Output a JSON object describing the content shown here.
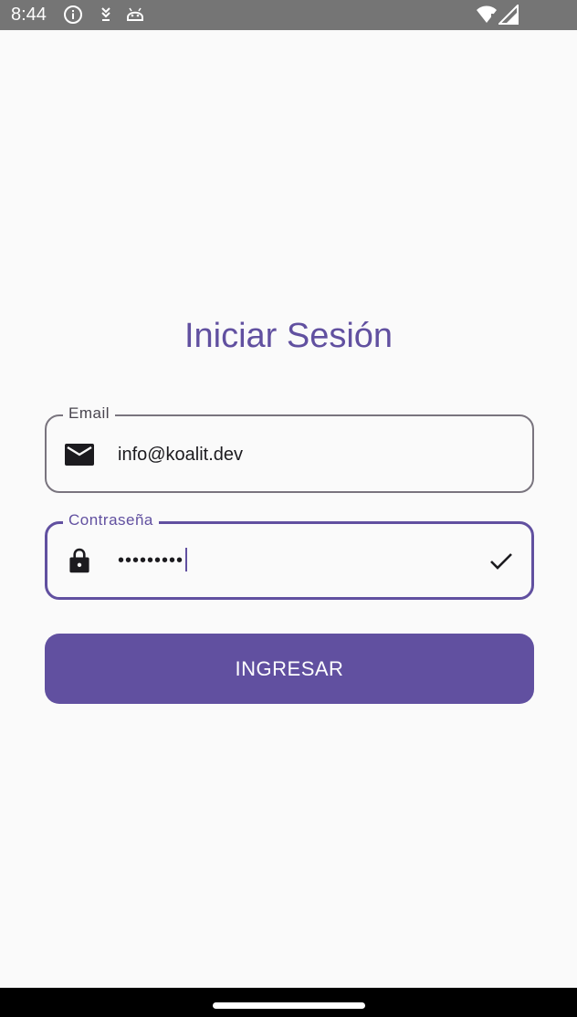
{
  "status_bar": {
    "time": "8:44",
    "icons": [
      "info-icon",
      "download-icon",
      "android-icon",
      "wifi-icon",
      "signal-icon"
    ]
  },
  "login": {
    "title": "Iniciar Sesión",
    "email": {
      "label": "Email",
      "value": "info@koalit.dev",
      "icon": "mail-icon"
    },
    "password": {
      "label": "Contraseña",
      "value": "•••••••••",
      "icon": "lock-icon",
      "trailing_icon": "check-icon"
    },
    "submit_label": "INGRESAR"
  },
  "colors": {
    "primary": "#6150a0",
    "background": "#fafafa",
    "status_bar": "#757575",
    "outline": "#79747e"
  }
}
